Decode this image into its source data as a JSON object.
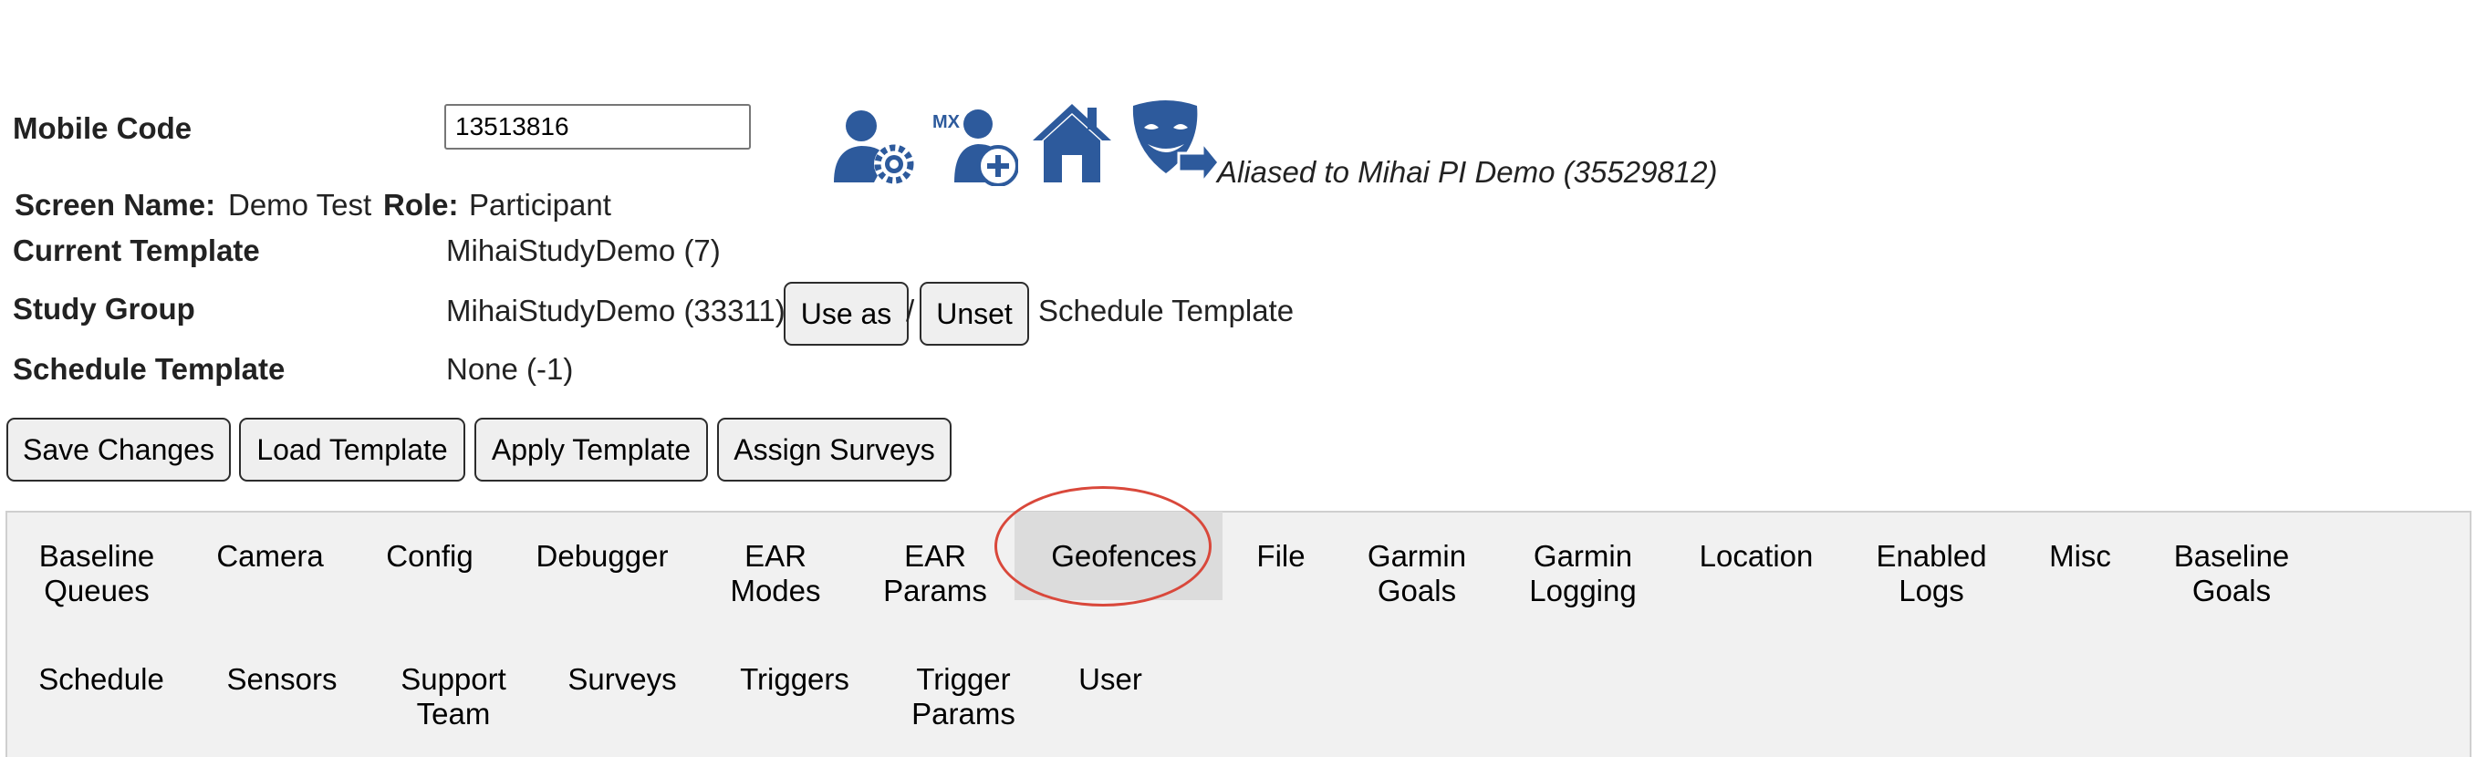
{
  "form": {
    "mobile_code_label": "Mobile Code",
    "mobile_code_value": "13513816",
    "screen_name_label": "Screen Name:",
    "screen_name_value": "Demo Test",
    "role_label": "Role:",
    "role_value": "Participant",
    "current_template_label": "Current Template",
    "current_template_value": "MihaiStudyDemo (7)",
    "study_group_label": "Study Group",
    "study_group_value": "MihaiStudyDemo (33311)",
    "use_as_label": "Use as",
    "slash": "/",
    "unset_label": "Unset",
    "schedule_template_suffix": "Schedule Template",
    "schedule_template_label": "Schedule Template",
    "schedule_template_value": "None (-1)"
  },
  "icons": {
    "user_settings": "user-settings-icon",
    "mx_add_user": "mx-add-user-icon",
    "mx_text": "MX",
    "home": "home-icon",
    "alias_mask": "alias-mask-icon",
    "brand_color": "#2d5a9c"
  },
  "alias_text": "Aliased to Mihai PI Demo (35529812)",
  "actions": {
    "save_changes": "Save Changes",
    "load_template": "Load Template",
    "apply_template": "Apply Template",
    "assign_surveys": "Assign Surveys"
  },
  "tabs": {
    "active": "Geofences",
    "highlight_color": "#d9483b",
    "baseline_queues": "Baseline\nQueues",
    "camera": "Camera",
    "config": "Config",
    "debugger": "Debugger",
    "ear_modes": "EAR\nModes",
    "ear_params": "EAR\nParams",
    "geofences": "Geofences",
    "file": "File",
    "garmin_goals": "Garmin\nGoals",
    "garmin_logging": "Garmin\nLogging",
    "location": "Location",
    "enabled_logs": "Enabled\nLogs",
    "misc": "Misc",
    "baseline_goals": "Baseline\nGoals",
    "schedule": "Schedule",
    "sensors": "Sensors",
    "support_team": "Support\nTeam",
    "surveys": "Surveys",
    "triggers": "Triggers",
    "trigger_params": "Trigger\nParams",
    "user": "User"
  }
}
